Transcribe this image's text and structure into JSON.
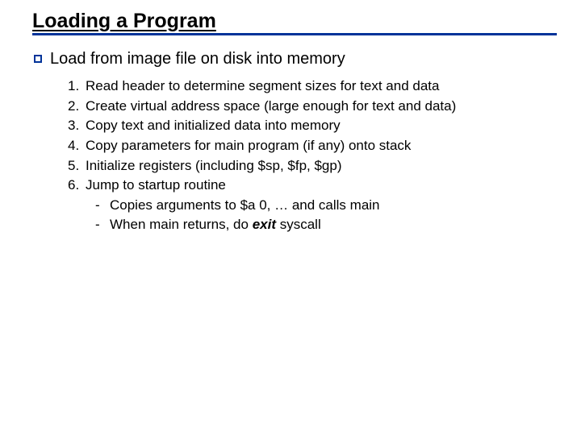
{
  "title": "Loading a Program",
  "main": {
    "heading": "Load from image file on disk into memory",
    "steps": [
      "Read header to determine segment sizes for text and data",
      "Create virtual address space (large enough for text and data)",
      "Copy text and initialized data into memory",
      "Copy parameters for main program (if any) onto stack",
      "Initialize registers (including $sp, $fp, $gp)",
      "Jump to startup routine"
    ],
    "substeps": {
      "a": "Copies arguments to $a 0, … and calls main",
      "b_prefix": "When main returns, do ",
      "b_emph": "exit",
      "b_suffix": " syscall"
    }
  }
}
